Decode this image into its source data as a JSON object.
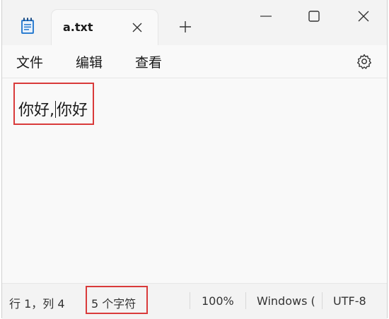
{
  "window": {
    "tab_title": "a.txt",
    "icons": [
      "notepad-icon",
      "close-icon",
      "plus-icon",
      "minimize-icon",
      "maximize-icon",
      "close-icon",
      "gear-icon"
    ],
    "accent_highlight": "#d93a3a"
  },
  "menu": {
    "file": "文件",
    "edit": "编辑",
    "view": "查看"
  },
  "editor": {
    "text_before_caret": "你好,",
    "text_after_caret": "你好"
  },
  "status": {
    "position": "行 1，列 4",
    "char_count": "5 个字符",
    "zoom": "100%",
    "line_ending": "Windows (",
    "encoding": "UTF-8"
  }
}
